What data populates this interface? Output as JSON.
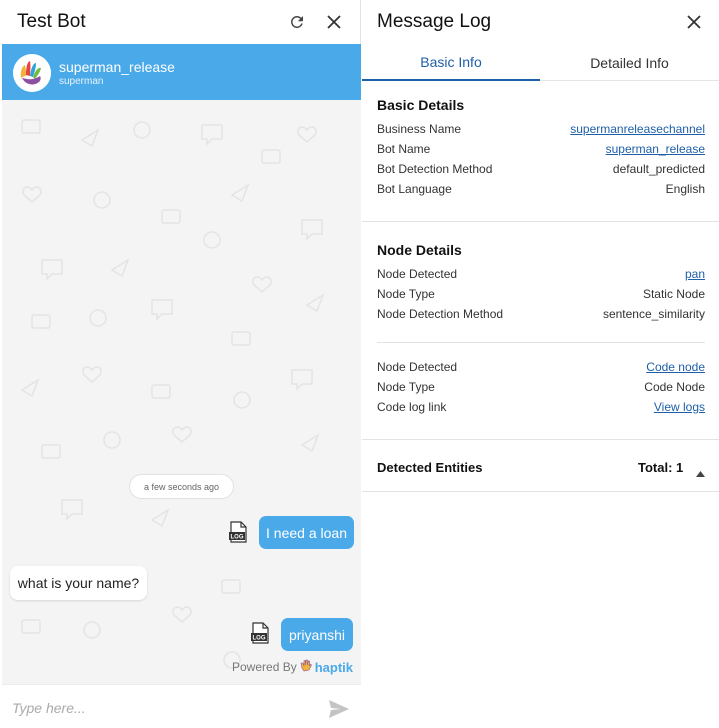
{
  "left_panel": {
    "title": "Test Bot",
    "bot": {
      "name": "superman_release",
      "subtitle": "superman"
    },
    "timestamp": "a few seconds ago",
    "messages": [
      {
        "from": "user",
        "text": "I need a loan"
      },
      {
        "from": "bot",
        "text": "what is your name?"
      },
      {
        "from": "user",
        "text": "priyanshi"
      }
    ],
    "log_label": "LOG",
    "powered_by": {
      "prefix": "Powered By",
      "brand": "haptik"
    },
    "input": {
      "placeholder": "Type here...",
      "value": ""
    }
  },
  "right_panel": {
    "title": "Message Log",
    "tabs": [
      "Basic Info",
      "Detailed Info"
    ],
    "basic_details": {
      "title": "Basic Details",
      "rows": [
        {
          "key": "Business Name",
          "value": "supermanreleasechannel"
        },
        {
          "key": "Bot Name",
          "value": "superman_release"
        },
        {
          "key": "Bot Detection Method",
          "value": "default_predicted"
        },
        {
          "key": "Bot Language",
          "value": "English"
        }
      ]
    },
    "node_details": {
      "title": "Node Details",
      "group1": [
        {
          "key": "Node Detected",
          "value": "pan"
        },
        {
          "key": "Node Type",
          "value": "Static Node"
        },
        {
          "key": "Node Detection Method",
          "value": "sentence_similarity"
        }
      ],
      "group2": [
        {
          "key": "Node Detected",
          "value": "Code node"
        },
        {
          "key": "Node Type",
          "value": "Code Node"
        },
        {
          "key": "Code log link",
          "value": "View logs"
        }
      ]
    },
    "entities": {
      "label": "Detected Entities",
      "total": "Total: 1"
    }
  },
  "colors": {
    "accent": "#4aa9e9",
    "link": "#1f5fa8",
    "chat_bg": "#f4f4f4"
  },
  "icons": [
    "refresh-icon",
    "close-icon",
    "bot-avatar",
    "log-icon",
    "hand-icon",
    "send-icon",
    "caret-up-icon"
  ]
}
